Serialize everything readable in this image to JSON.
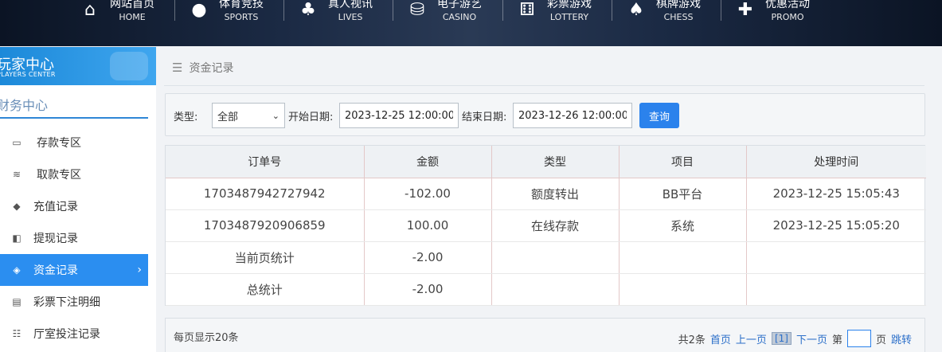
{
  "nav": {
    "items": [
      {
        "zh": "网站首页",
        "en": "HOME",
        "icon": "home-icon",
        "glyph": "⌂"
      },
      {
        "zh": "体育竞技",
        "en": "SPORTS",
        "icon": "basketball-icon",
        "glyph": "●"
      },
      {
        "zh": "真人视讯",
        "en": "LIVES",
        "icon": "cards-icon",
        "glyph": "♣"
      },
      {
        "zh": "电子游艺",
        "en": "CASINO",
        "icon": "slot-icon",
        "glyph": "⛁"
      },
      {
        "zh": "彩票游戏",
        "en": "LOTTERY",
        "icon": "dice-icon",
        "glyph": "⚅"
      },
      {
        "zh": "棋牌游戏",
        "en": "CHESS",
        "icon": "spade-icon",
        "glyph": "♠"
      },
      {
        "zh": "优惠活动",
        "en": "PROMO",
        "icon": "gift-icon",
        "glyph": "✚"
      }
    ]
  },
  "sidebar": {
    "header_zh": "玩家中心",
    "header_en": "PLAYERS CENTER",
    "section_title": "财务中心",
    "items": [
      {
        "label": "存款专区",
        "icon": "deposit-icon",
        "glyph": "▭"
      },
      {
        "label": "取款专区",
        "icon": "withdraw-icon",
        "glyph": "≋"
      },
      {
        "label": "充值记录",
        "icon": "moneybag-icon",
        "glyph": "◆"
      },
      {
        "label": "提现记录",
        "icon": "wallet-icon",
        "glyph": "◧"
      },
      {
        "label": "资金记录",
        "icon": "fund-icon",
        "glyph": "◈",
        "active": true
      },
      {
        "label": "彩票下注明细",
        "icon": "lottery-list-icon",
        "glyph": "▤"
      },
      {
        "label": "厅室投注记录",
        "icon": "bet-list-icon",
        "glyph": "☷"
      }
    ]
  },
  "main": {
    "breadcrumb": "资金记录",
    "filter": {
      "type_label": "类型:",
      "type_value": "全部",
      "start_label": "开始日期:",
      "start_value": "2023-12-25 12:00:00",
      "end_label": "结束日期:",
      "end_value": "2023-12-26 12:00:00",
      "query_button": "查询"
    },
    "table": {
      "headers": [
        "订单号",
        "金额",
        "类型",
        "项目",
        "处理时间"
      ],
      "rows": [
        [
          "1703487942727942",
          "-102.00",
          "额度转出",
          "BB平台",
          "2023-12-25 15:05:43"
        ],
        [
          "1703487920906859",
          "100.00",
          "在线存款",
          "系统",
          "2023-12-25 15:05:20"
        ],
        [
          "当前页统计",
          "-2.00",
          "",
          "",
          ""
        ],
        [
          "总统计",
          "-2.00",
          "",
          "",
          ""
        ]
      ]
    },
    "pager": {
      "per_page": "每页显示20条",
      "total": "共2条",
      "first": "首页",
      "prev": "上一页",
      "current": "[1]",
      "next": "下一页",
      "page_prefix": "第",
      "page_suffix": "页",
      "jump": "跳转"
    }
  },
  "colors": {
    "accent": "#2b8ef0",
    "sidebar_header": "#1c89d9",
    "query_button": "#2b82ec"
  }
}
